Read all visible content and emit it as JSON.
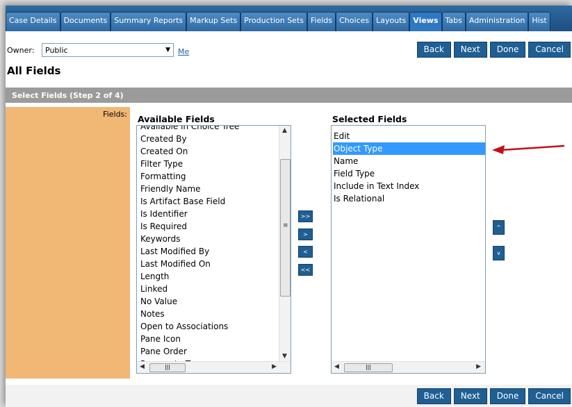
{
  "tabs": [
    "Case Details",
    "Documents",
    "Summary Reports",
    "Markup Sets",
    "Production Sets",
    "Fields",
    "Choices",
    "Layouts",
    "Views",
    "Tabs",
    "Administration",
    "Hist"
  ],
  "active_tab": "Views",
  "owner": {
    "label": "Owner:",
    "value": "Public",
    "me_link": "Me"
  },
  "buttons": {
    "back": "Back",
    "next": "Next",
    "done": "Done",
    "cancel": "Cancel"
  },
  "page_title": "All Fields",
  "step_header": "Select Fields (Step 2 of 4)",
  "fields_label": "Fields:",
  "available": {
    "title": "Available Fields",
    "partial_top": "Available in Choice Tree",
    "items": [
      "Created By",
      "Created On",
      "Filter Type",
      "Formatting",
      "Friendly Name",
      "Is Artifact Base Field",
      "Is Identifier",
      "Is Required",
      "Keywords",
      "Last Modified By",
      "Last Modified On",
      "Length",
      "Linked",
      "No Value",
      "Notes",
      "Open to Associations",
      "Pane Icon",
      "Pane Order"
    ],
    "partial_bottom": "Propagate To"
  },
  "selected": {
    "title": "Selected Fields",
    "items": [
      "Edit",
      "Object Type",
      "Name",
      "Field Type",
      "Include in Text Index",
      "Is Relational"
    ],
    "highlighted_index": 1
  },
  "move_buttons": {
    "add_all": ">>",
    "add": ">",
    "remove": "<",
    "remove_all": "<<"
  },
  "order_buttons": {
    "up": "^",
    "down": "v"
  },
  "colors": {
    "accent": "#1f5f93",
    "tab_bar": "#2e6aa0",
    "left_panel": "#f1b774",
    "selection": "#3399ff",
    "arrow": "#c0101a"
  }
}
